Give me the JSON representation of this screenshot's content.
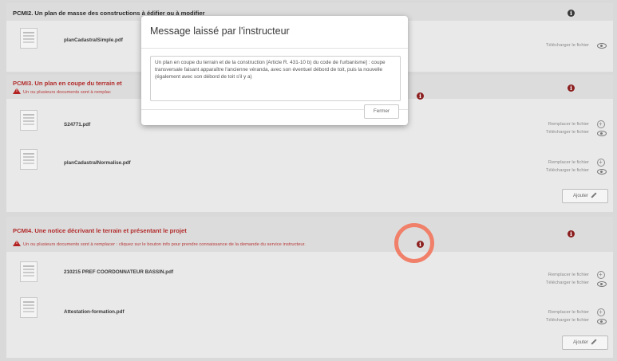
{
  "sections": [
    {
      "title": "PCMI2. Un plan de masse des constructions à édifier ou à modifier",
      "files": [
        {
          "name": "planCadastralSimple.pdf",
          "actions": [
            "Télécharger le fichier"
          ]
        }
      ]
    },
    {
      "title": "PCMI3. Un plan en coupe du terrain et",
      "warning": "Un ou plusieurs documents sont à remplac",
      "files": [
        {
          "name": "S24771.pdf",
          "actions": [
            "Remplacer le fichier",
            "Télécharger le fichier"
          ]
        },
        {
          "name": "planCadastralNormalise.pdf",
          "actions": [
            "Remplacer le fichier",
            "Télécharger le fichier"
          ]
        }
      ],
      "add_label": "Ajouter"
    },
    {
      "title": "PCMI4. Une notice décrivant le terrain et présentant le projet",
      "warning": "Un ou plusieurs documents sont à remplacer : cliquez sur le bouton info pour prendre connaissance de la demande du service instructeur.",
      "files": [
        {
          "name": "210215 PREF COORDONNATEUR BASSIN.pdf",
          "actions": [
            "Remplacer le fichier",
            "Télécharger le fichier"
          ]
        },
        {
          "name": "Attestation-formation.pdf",
          "actions": [
            "Remplacer le fichier",
            "Télécharger le fichier"
          ]
        }
      ],
      "add_label": "Ajouter"
    }
  ],
  "modal": {
    "title": "Message laissé par l'instructeur",
    "message": "Un plan en coupe du terrain et de la construction [Article R. 431-10 b) du code de l'urbanisme] : coupe transversale faisant apparaître l'ancienne véranda, avec son éventuel débord de toit, puis la nouvelle (également avec son débord de toit s'il y a)",
    "close_label": "Fermer"
  },
  "colors": {
    "error_red": "#b22a2a",
    "highlight_circle": "#f08069"
  },
  "icons": {
    "info": "info-circle-icon",
    "warning": "warning-triangle-icon",
    "view": "eye-icon",
    "replace": "plus-circle-icon",
    "edit": "pencil-icon"
  }
}
